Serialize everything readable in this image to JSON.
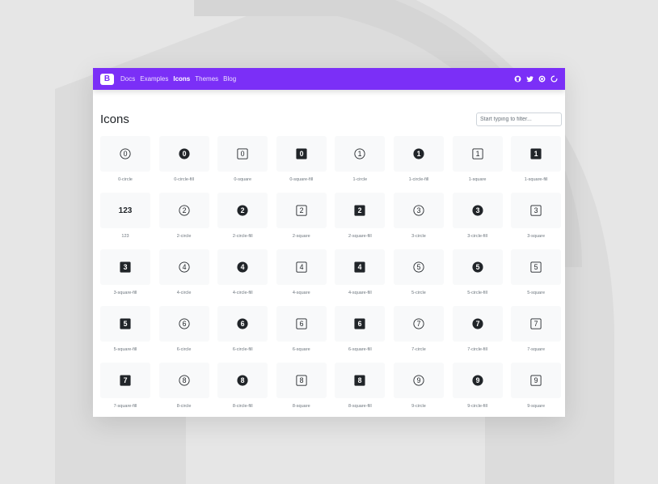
{
  "navbar": {
    "brand": "B",
    "links": [
      "Docs",
      "Examples",
      "Icons",
      "Themes",
      "Blog"
    ],
    "active": "Icons",
    "right_icons": [
      "github-icon",
      "twitter-icon",
      "opencollective-icon",
      "loading-icon"
    ]
  },
  "page": {
    "title": "Icons",
    "filter_placeholder": "Start typing to filter..."
  },
  "colors": {
    "brand": "#7b2ff7",
    "tile": "#f8f9fa",
    "icon": "#212529"
  },
  "icons": [
    {
      "label": "0-circle",
      "glyph": "0",
      "shape": "circle",
      "fill": false
    },
    {
      "label": "0-circle-fill",
      "glyph": "0",
      "shape": "circle",
      "fill": true
    },
    {
      "label": "0-square",
      "glyph": "0",
      "shape": "square",
      "fill": false
    },
    {
      "label": "0-square-fill",
      "glyph": "0",
      "shape": "square",
      "fill": true
    },
    {
      "label": "1-circle",
      "glyph": "1",
      "shape": "circle",
      "fill": false
    },
    {
      "label": "1-circle-fill",
      "glyph": "1",
      "shape": "circle",
      "fill": true
    },
    {
      "label": "1-square",
      "glyph": "1",
      "shape": "square",
      "fill": false
    },
    {
      "label": "1-square-fill",
      "glyph": "1",
      "shape": "square",
      "fill": true
    },
    {
      "label": "123",
      "glyph": "123",
      "shape": "text",
      "fill": false
    },
    {
      "label": "2-circle",
      "glyph": "2",
      "shape": "circle",
      "fill": false
    },
    {
      "label": "2-circle-fill",
      "glyph": "2",
      "shape": "circle",
      "fill": true
    },
    {
      "label": "2-square",
      "glyph": "2",
      "shape": "square",
      "fill": false
    },
    {
      "label": "2-square-fill",
      "glyph": "2",
      "shape": "square",
      "fill": true
    },
    {
      "label": "3-circle",
      "glyph": "3",
      "shape": "circle",
      "fill": false
    },
    {
      "label": "3-circle-fill",
      "glyph": "3",
      "shape": "circle",
      "fill": true
    },
    {
      "label": "3-square",
      "glyph": "3",
      "shape": "square",
      "fill": false
    },
    {
      "label": "3-square-fill",
      "glyph": "3",
      "shape": "square",
      "fill": true
    },
    {
      "label": "4-circle",
      "glyph": "4",
      "shape": "circle",
      "fill": false
    },
    {
      "label": "4-circle-fill",
      "glyph": "4",
      "shape": "circle",
      "fill": true
    },
    {
      "label": "4-square",
      "glyph": "4",
      "shape": "square",
      "fill": false
    },
    {
      "label": "4-square-fill",
      "glyph": "4",
      "shape": "square",
      "fill": true
    },
    {
      "label": "5-circle",
      "glyph": "5",
      "shape": "circle",
      "fill": false
    },
    {
      "label": "5-circle-fill",
      "glyph": "5",
      "shape": "circle",
      "fill": true
    },
    {
      "label": "5-square",
      "glyph": "5",
      "shape": "square",
      "fill": false
    },
    {
      "label": "5-square-fill",
      "glyph": "5",
      "shape": "square",
      "fill": true
    },
    {
      "label": "6-circle",
      "glyph": "6",
      "shape": "circle",
      "fill": false
    },
    {
      "label": "6-circle-fill",
      "glyph": "6",
      "shape": "circle",
      "fill": true
    },
    {
      "label": "6-square",
      "glyph": "6",
      "shape": "square",
      "fill": false
    },
    {
      "label": "6-square-fill",
      "glyph": "6",
      "shape": "square",
      "fill": true
    },
    {
      "label": "7-circle",
      "glyph": "7",
      "shape": "circle",
      "fill": false
    },
    {
      "label": "7-circle-fill",
      "glyph": "7",
      "shape": "circle",
      "fill": true
    },
    {
      "label": "7-square",
      "glyph": "7",
      "shape": "square",
      "fill": false
    },
    {
      "label": "7-square-fill",
      "glyph": "7",
      "shape": "square",
      "fill": true
    },
    {
      "label": "8-circle",
      "glyph": "8",
      "shape": "circle",
      "fill": false
    },
    {
      "label": "8-circle-fill",
      "glyph": "8",
      "shape": "circle",
      "fill": true
    },
    {
      "label": "8-square",
      "glyph": "8",
      "shape": "square",
      "fill": false
    },
    {
      "label": "8-square-fill",
      "glyph": "8",
      "shape": "square",
      "fill": true
    },
    {
      "label": "9-circle",
      "glyph": "9",
      "shape": "circle",
      "fill": false
    },
    {
      "label": "9-circle-fill",
      "glyph": "9",
      "shape": "circle",
      "fill": true
    },
    {
      "label": "9-square",
      "glyph": "9",
      "shape": "square",
      "fill": false
    }
  ]
}
